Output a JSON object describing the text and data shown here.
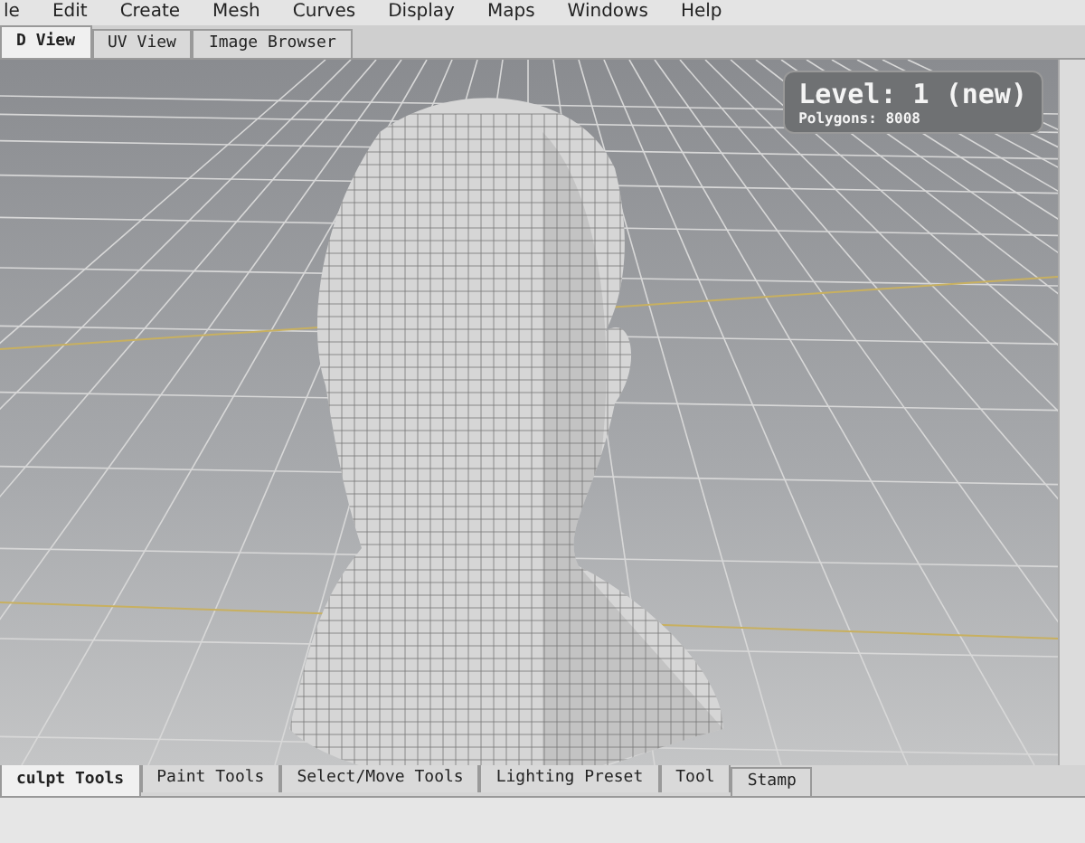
{
  "menu": [
    {
      "label": "le"
    },
    {
      "label": "Edit"
    },
    {
      "label": "Create"
    },
    {
      "label": "Mesh"
    },
    {
      "label": "Curves"
    },
    {
      "label": "Display"
    },
    {
      "label": "Maps"
    },
    {
      "label": "Windows"
    },
    {
      "label": "Help"
    }
  ],
  "view_tabs": [
    {
      "label": "D View",
      "selected": true
    },
    {
      "label": "UV View",
      "selected": false
    },
    {
      "label": "Image Browser",
      "selected": false
    }
  ],
  "viewport": {
    "hud": {
      "level": "Level: 1 (new)",
      "polygons": "Polygons: 8008"
    }
  },
  "tool_tabs": [
    {
      "label": "culpt Tools",
      "selected": true
    },
    {
      "label": "Paint Tools",
      "selected": false
    },
    {
      "label": "Select/Move Tools",
      "selected": false
    },
    {
      "label": "Lighting Preset",
      "selected": false
    },
    {
      "label": "Tool",
      "selected": false
    }
  ],
  "side_tabs": [
    {
      "label": "Stamp",
      "selected": false
    }
  ]
}
